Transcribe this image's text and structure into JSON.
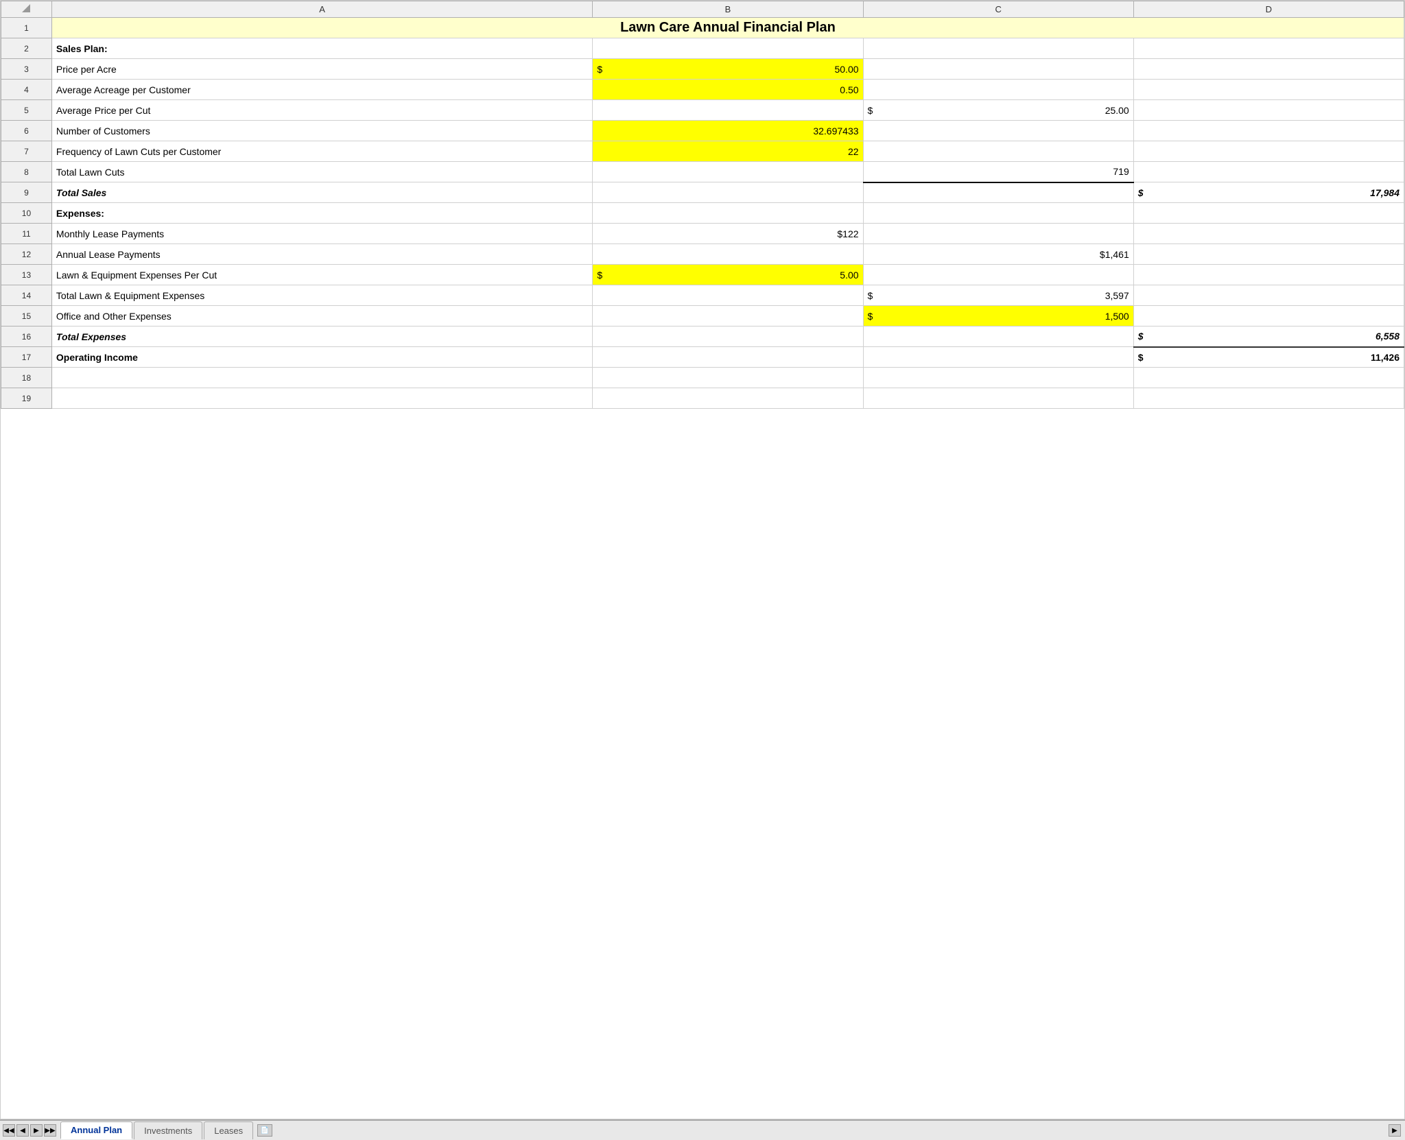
{
  "title": "Lawn Care Annual Financial Plan",
  "columns": {
    "corner": "",
    "A": "A",
    "B": "B",
    "C": "C",
    "D": "D"
  },
  "rows": [
    {
      "num": "1",
      "type": "title",
      "A": "Lawn Care Annual Financial Plan",
      "B": "",
      "C": "",
      "D": ""
    },
    {
      "num": "2",
      "type": "section-header",
      "A": "Sales Plan:",
      "B": "",
      "C": "",
      "D": ""
    },
    {
      "num": "3",
      "type": "data",
      "A": "Price per Acre",
      "B_dollar": "$",
      "B_val": "50.00",
      "B_highlight": true,
      "C": "",
      "D": ""
    },
    {
      "num": "4",
      "type": "data",
      "A": "Average Acreage per Customer",
      "B_val": "0.50",
      "B_highlight": true,
      "C": "",
      "D": ""
    },
    {
      "num": "5",
      "type": "data",
      "A": "Average Price per Cut",
      "B": "",
      "C_dollar": "$",
      "C_val": "25.00",
      "D": ""
    },
    {
      "num": "6",
      "type": "data",
      "A": "Number of Customers",
      "B_val": "32.697433",
      "B_highlight": true,
      "C": "",
      "D": ""
    },
    {
      "num": "7",
      "type": "data",
      "A": "Frequency of Lawn Cuts per Customer",
      "B_val": "22",
      "B_highlight": true,
      "C": "",
      "D": ""
    },
    {
      "num": "8",
      "type": "data",
      "A": "Total Lawn Cuts",
      "B": "",
      "C_val": "719",
      "C_underline": true,
      "D": ""
    },
    {
      "num": "9",
      "type": "total",
      "A": "Total Sales",
      "B": "",
      "C": "",
      "D_dollar": "$",
      "D_val": "17,984"
    },
    {
      "num": "10",
      "type": "section-header",
      "A": "Expenses:",
      "B": "",
      "C": "",
      "D": ""
    },
    {
      "num": "11",
      "type": "data",
      "A": "Monthly Lease Payments",
      "B_val": "$122",
      "C": "",
      "D": ""
    },
    {
      "num": "12",
      "type": "data",
      "A": "Annual Lease Payments",
      "B": "",
      "C_val": "$1,461",
      "D": ""
    },
    {
      "num": "13",
      "type": "data",
      "A": "Lawn & Equipment Expenses Per Cut",
      "B_dollar": "$",
      "B_val": "5.00",
      "B_highlight": true,
      "C": "",
      "D": ""
    },
    {
      "num": "14",
      "type": "data",
      "A": "Total Lawn & Equipment Expenses",
      "B": "",
      "C_dollar": "$",
      "C_val": "3,597",
      "D": ""
    },
    {
      "num": "15",
      "type": "data",
      "A": "Office and Other Expenses",
      "B": "",
      "C_dollar": "$",
      "C_val": "1,500",
      "C_highlight": true,
      "D": ""
    },
    {
      "num": "16",
      "type": "total",
      "A": "Total Expenses",
      "B": "",
      "C": "",
      "D_dollar": "$",
      "D_val": "6,558",
      "D_underline": true
    },
    {
      "num": "17",
      "type": "operating",
      "A": "Operating Income",
      "B": "",
      "C": "",
      "D_dollar": "$",
      "D_val": "11,426"
    },
    {
      "num": "18",
      "type": "empty",
      "A": "",
      "B": "",
      "C": "",
      "D": ""
    },
    {
      "num": "19",
      "type": "empty",
      "A": "",
      "B": "",
      "C": "",
      "D": ""
    }
  ],
  "tabs": [
    {
      "label": "Annual Plan",
      "active": true
    },
    {
      "label": "Investments",
      "active": false
    },
    {
      "label": "Leases",
      "active": false
    }
  ],
  "nav_buttons": [
    "◀◀",
    "◀",
    "▶",
    "▶▶"
  ]
}
